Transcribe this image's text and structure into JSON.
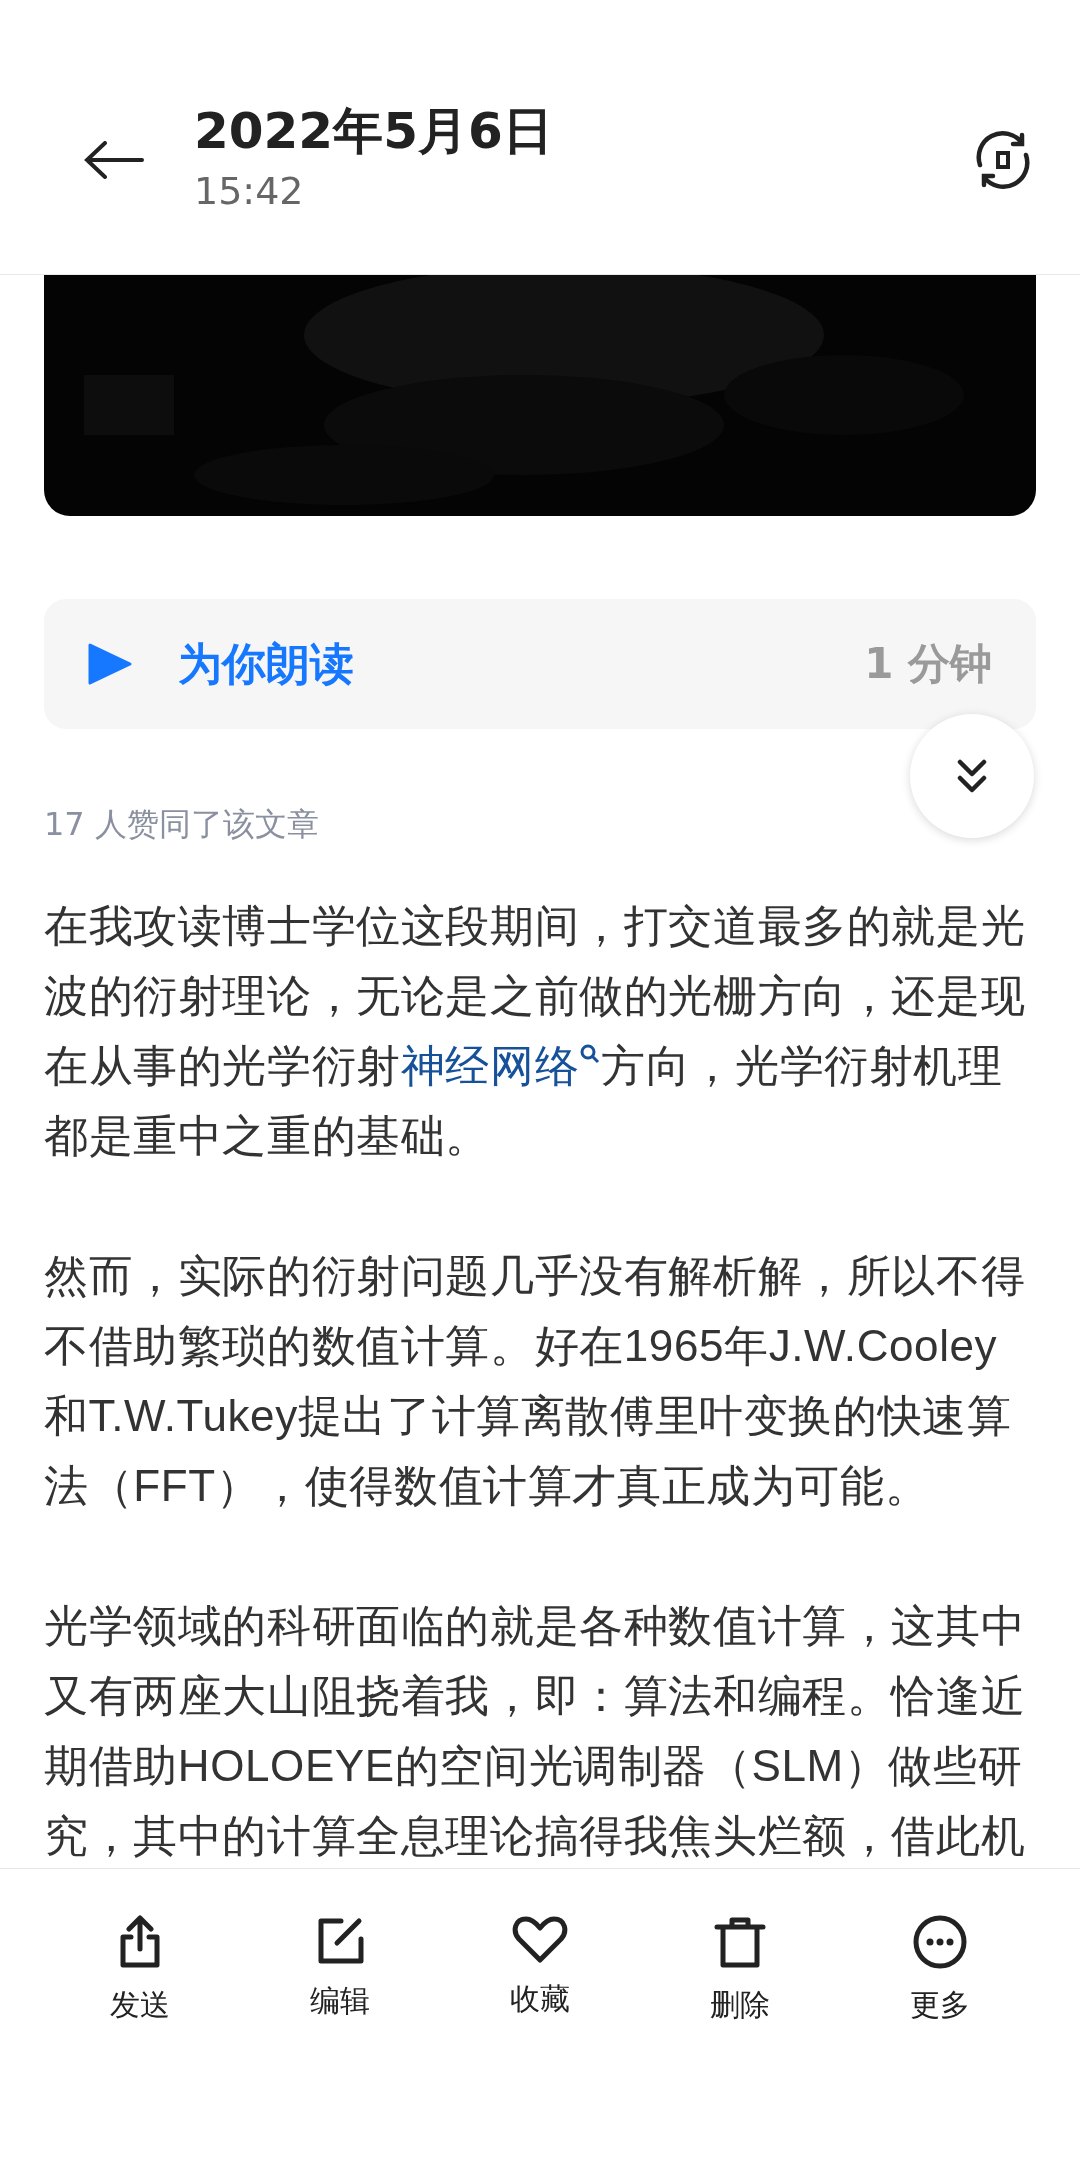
{
  "header": {
    "title": "2022年5月6日",
    "time": "15:42"
  },
  "read_aloud": {
    "label": "为你朗读",
    "duration": "1 分钟"
  },
  "likes": "17 人赞同了该文章",
  "paragraphs": [
    [
      {
        "kind": "text",
        "text": "在我攻读博士学位这段期间，打交道最多的就是光波的衍射理论，无论是之前做的光栅方向，还是现在从事的光学衍射"
      },
      {
        "kind": "link",
        "text": "神经网络"
      },
      {
        "kind": "text",
        "text": "方向，光学衍射机理都是重中之重的基础。"
      }
    ],
    [
      {
        "kind": "text",
        "text": "然而，实际的衍射问题几乎没有解析解，所以不得不借助繁琐的数值计算。好在1965年J.W.Cooley和T.W.Tukey提出了计算离散傅里叶变换的快速算法（FFT），使得数值计算才真正成为可能。"
      }
    ],
    [
      {
        "kind": "text",
        "text": "光学领域的科研面临的就是各种数值计算，这其中又有两座大山阻挠着我，即：算法和编程。恰逢近期借助HOLOEYE的空间光调制器（SLM）做些研究，其中的计算全息理论搞得我焦头烂额，借此机"
      }
    ]
  ],
  "actions": [
    {
      "kind": "share",
      "label": "发送"
    },
    {
      "kind": "edit",
      "label": "编辑"
    },
    {
      "kind": "favorite",
      "label": "收藏"
    },
    {
      "kind": "delete",
      "label": "删除"
    },
    {
      "kind": "more",
      "label": "更多"
    }
  ]
}
